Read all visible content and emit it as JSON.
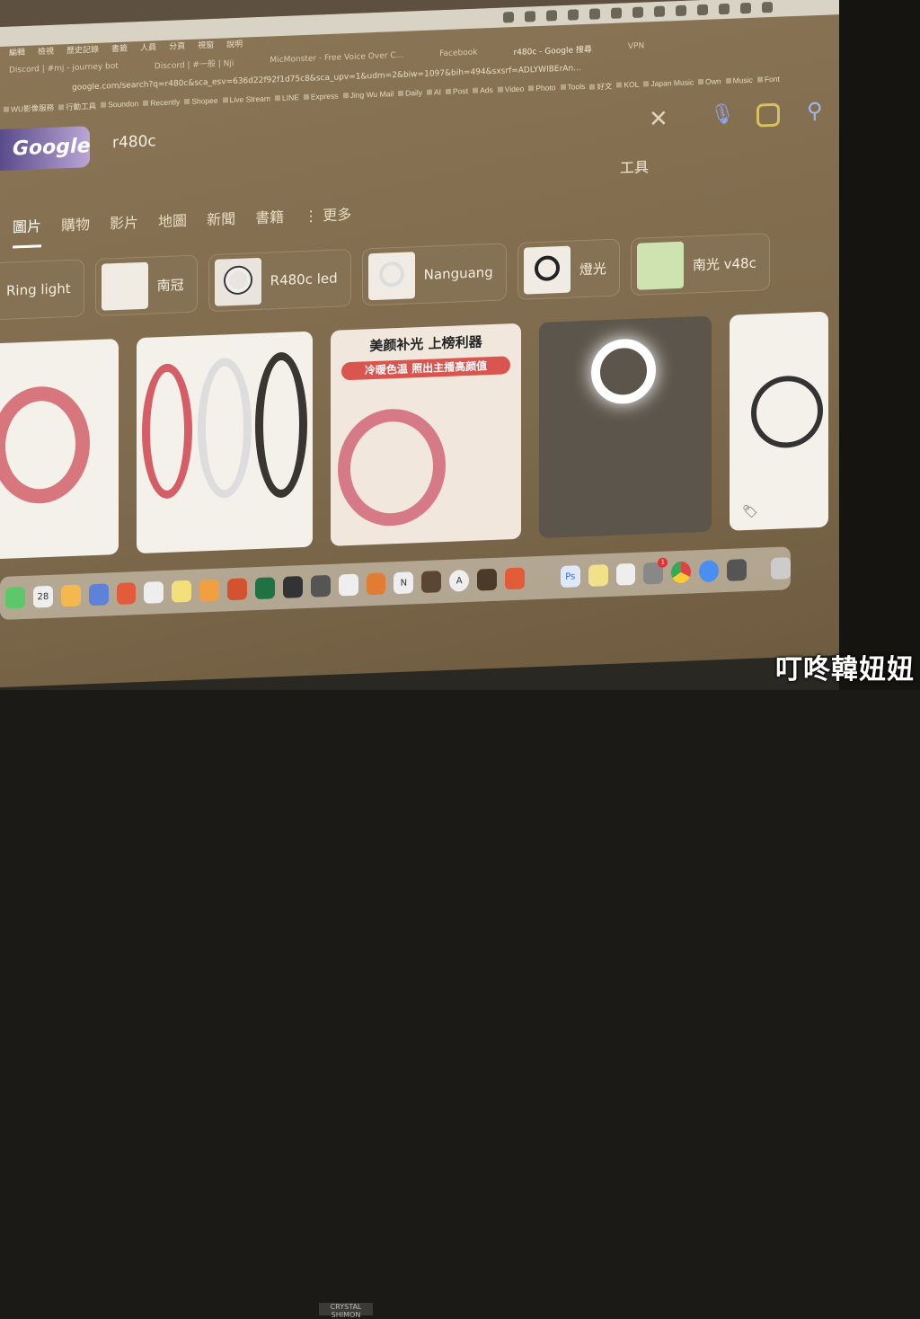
{
  "menubar": {
    "icons": [
      "mic-icon",
      "grid-icon",
      "location-icon",
      "moon-icon",
      "download-icon",
      "cat-icon",
      "record-icon",
      "volume-icon",
      "eject-icon",
      "bluetooth-icon",
      "battery-icon",
      "wifi-icon",
      "search-icon"
    ]
  },
  "browser_menu": [
    "編輯",
    "檢視",
    "歷史記錄",
    "書籤",
    "人員",
    "分頁",
    "視窗",
    "說明"
  ],
  "tabs": [
    {
      "label": "Discord | #mj - journey bot"
    },
    {
      "label": "Discord | #一般 | Nji"
    },
    {
      "label": "MicMonster - Free Voice Over C..."
    },
    {
      "label": "Facebook"
    },
    {
      "label": "r480c - Google 搜尋",
      "active": true
    }
  ],
  "url": "google.com/search?q=r480c&sca_esv=636d22f92f1d75c8&sca_upv=1&udm=2&biw=1097&bih=494&sxsrf=ADLYWIBErAn...",
  "vpn_label": "VPN",
  "bookmarks": [
    "WU影像服務",
    "行動工具",
    "Soundon",
    "Recently",
    "Shopee",
    "Live Stream",
    "LINE",
    "Express",
    "Jing Wu Mail",
    "Daily",
    "AI",
    "Post",
    "Ads",
    "Video",
    "Photo",
    "Tools",
    "好文",
    "KOL",
    "Japan Music",
    "Own",
    "Music",
    "Font"
  ],
  "search": {
    "logo": "Google",
    "query": "r480c"
  },
  "tools_label": "工具",
  "nav_tabs": [
    {
      "label": "圖片",
      "active": true
    },
    {
      "label": "購物"
    },
    {
      "label": "影片"
    },
    {
      "label": "地圖"
    },
    {
      "label": "新聞"
    },
    {
      "label": "書籍"
    },
    {
      "label": "更多"
    }
  ],
  "chips": [
    "Ring light",
    "南冠",
    "R480c led",
    "Nanguang",
    "燈光",
    "南光 v48c"
  ],
  "promo": {
    "headline": "美颜补光 上榜利器",
    "sub": "冷暖色温 照出主播高颜值"
  },
  "dock": {
    "calendar_day": "28",
    "badge_count": "1"
  },
  "screen_plate": "CRYSTAL SHIMON",
  "watermark": "叮咚韓妞妞"
}
